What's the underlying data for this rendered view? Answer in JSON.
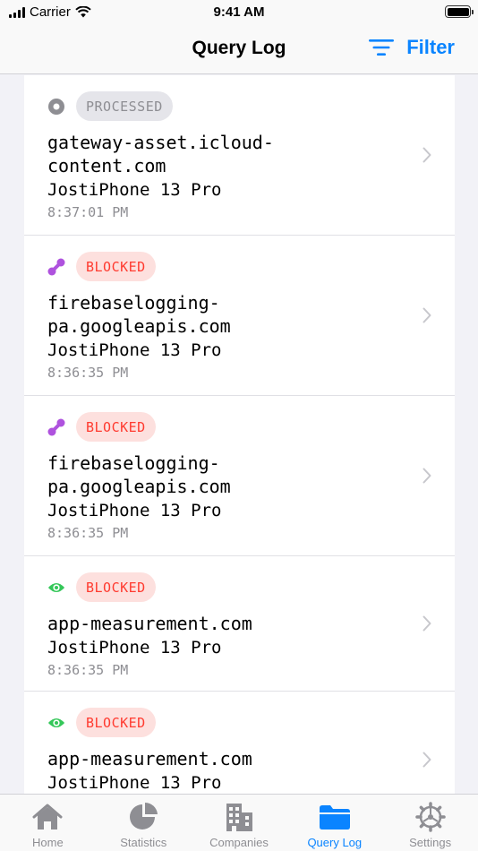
{
  "status_bar": {
    "carrier": "Carrier",
    "time": "9:41 AM"
  },
  "nav": {
    "title": "Query Log",
    "filter_label": "Filter"
  },
  "colors": {
    "accent": "#0a84ff",
    "processed_bg": "#e5e5ea",
    "processed_text": "#8e8e93",
    "blocked_bg": "#fde0de",
    "blocked_text": "#ff3b30",
    "purple": "#af52de",
    "green": "#34c759",
    "gray_icon": "#8e8e93"
  },
  "entries": [
    {
      "icon": "processed-icon",
      "status": "PROCESSED",
      "domain": "gateway-asset.icloud-\ncontent.com",
      "device": "JostiPhone 13 Pro",
      "time": "8:37:01 PM"
    },
    {
      "icon": "link-icon",
      "status": "BLOCKED",
      "domain": "firebaselogging-\npa.googleapis.com",
      "device": "JostiPhone 13 Pro",
      "time": "8:36:35 PM"
    },
    {
      "icon": "link-icon",
      "status": "BLOCKED",
      "domain": "firebaselogging-\npa.googleapis.com",
      "device": "JostiPhone 13 Pro",
      "time": "8:36:35 PM"
    },
    {
      "icon": "eye-icon",
      "status": "BLOCKED",
      "domain": "app-measurement.com",
      "device": "JostiPhone 13 Pro",
      "time": "8:36:35 PM"
    },
    {
      "icon": "eye-icon",
      "status": "BLOCKED",
      "domain": "app-measurement.com",
      "device": "JostiPhone 13 Pro",
      "time": ""
    }
  ],
  "tabs": [
    {
      "label": "Home",
      "icon": "home-icon"
    },
    {
      "label": "Statistics",
      "icon": "pie-chart-icon"
    },
    {
      "label": "Companies",
      "icon": "building-icon"
    },
    {
      "label": "Query Log",
      "icon": "folder-icon",
      "active": true
    },
    {
      "label": "Settings",
      "icon": "gear-icon"
    }
  ]
}
